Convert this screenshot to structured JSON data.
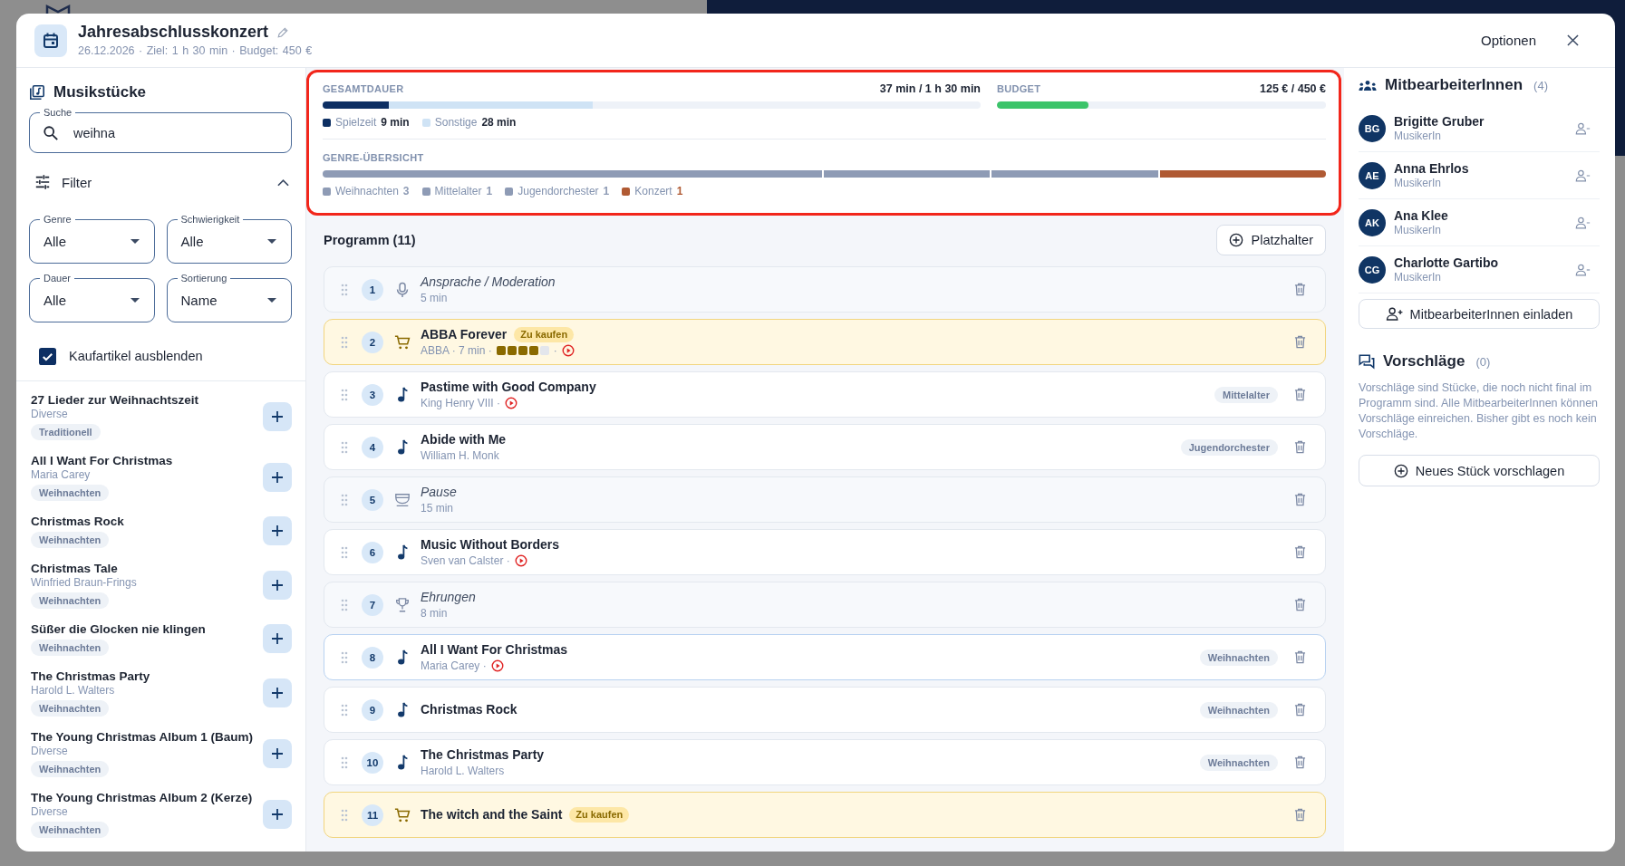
{
  "window": {
    "title": "Jahresabschlusskonzert",
    "meta": "26.12.2026 · Ziel: 1 h 30 min · Budget: 450 €",
    "options": "Optionen"
  },
  "library": {
    "title": "Musikstücke",
    "search": {
      "label": "Suche",
      "value": "weihna"
    },
    "filter": {
      "label": "Filter",
      "expanded": true
    },
    "selects": [
      {
        "label": "Genre",
        "value": "Alle"
      },
      {
        "label": "Schwierigkeit",
        "value": "Alle"
      },
      {
        "label": "Dauer",
        "value": "Alle"
      },
      {
        "label": "Sortierung",
        "value": "Name"
      }
    ],
    "hide_purchases": {
      "label": "Kaufartikel ausblenden",
      "checked": true
    },
    "items": [
      {
        "title": "27 Lieder zur Weihnachtszeit",
        "composer": "Diverse",
        "tag": "Traditionell"
      },
      {
        "title": "All I Want For Christmas",
        "composer": "Maria Carey",
        "tag": "Weihnachten"
      },
      {
        "title": "Christmas Rock",
        "tag": "Weihnachten"
      },
      {
        "title": "Christmas Tale",
        "composer": "Winfried Braun-Frings",
        "tag": "Weihnachten"
      },
      {
        "title": "Süßer die Glocken nie klingen",
        "tag": "Weihnachten"
      },
      {
        "title": "The Christmas Party",
        "composer": "Harold L. Walters",
        "tag": "Weihnachten"
      },
      {
        "title": "The Young Christmas Album 1 (Baum)",
        "composer": "Diverse",
        "tag": "Weihnachten"
      },
      {
        "title": "The Young Christmas Album 2 (Kerze)",
        "composer": "Diverse",
        "tag": "Weihnachten"
      }
    ]
  },
  "summary": {
    "duration": {
      "label": "GESAMTDAUER",
      "reading": "37 min / 1 h 30 min",
      "level": 0.411,
      "segments": [
        {
          "name": "Spielzeit",
          "value": "9 min",
          "level": 0.1,
          "color": "#0d2f63"
        },
        {
          "name": "Sonstige",
          "value": "28 min",
          "color": "#cfe3f5"
        }
      ]
    },
    "budget": {
      "label": "BUDGET",
      "reading": "125 € / 450 €",
      "level": 0.278
    },
    "genres": {
      "label": "GENRE-ÜBERSICHT",
      "items": [
        {
          "name": "Weihnachten",
          "count": "3",
          "color": "#8e9bb5"
        },
        {
          "name": "Mittelalter",
          "count": "1",
          "color": "#8e9bb5"
        },
        {
          "name": "Jugendorchester",
          "count": "1",
          "color": "#8e9bb5"
        },
        {
          "name": "Konzert",
          "count": "1",
          "color": "#b05a33"
        }
      ]
    }
  },
  "program": {
    "title": "Programm (11)",
    "add_placeholder": "Platzhalter",
    "items": [
      {
        "number": "1",
        "kind": "speech",
        "title": "Ansprache / Moderation",
        "details": "5 min",
        "selected": false
      },
      {
        "number": "2",
        "kind": "purchase",
        "title": "ABBA Forever",
        "badge": "Zu kaufen",
        "details": "ABBA · 7 min ·",
        "stars": 4,
        "separator": "·",
        "audio": true,
        "selected": false
      },
      {
        "number": "3",
        "kind": "song",
        "title": "Pastime with Good Company",
        "details": "King Henry VIII ·",
        "audio": true,
        "genre": "Mittelalter",
        "selected": false
      },
      {
        "number": "4",
        "kind": "song",
        "title": "Abide with Me",
        "details": "William H. Monk",
        "genre": "Jugendorchester",
        "selected": false
      },
      {
        "number": "5",
        "kind": "pause",
        "title": "Pause",
        "details": "15 min",
        "selected": false
      },
      {
        "number": "6",
        "kind": "song",
        "title": "Music Without Borders",
        "details": "Sven van Calster ·",
        "audio": true,
        "selected": false
      },
      {
        "number": "7",
        "kind": "honors",
        "title": "Ehrungen",
        "details": "8 min",
        "selected": false
      },
      {
        "number": "8",
        "kind": "song",
        "title": "All I Want For Christmas",
        "details": "Maria Carey ·",
        "audio": true,
        "genre": "Weihnachten",
        "selected": true
      },
      {
        "number": "9",
        "kind": "song",
        "title": "Christmas Rock",
        "genre": "Weihnachten",
        "selected": false
      },
      {
        "number": "10",
        "kind": "song",
        "title": "The Christmas Party",
        "details": "Harold L. Walters",
        "genre": "Weihnachten",
        "selected": false
      },
      {
        "number": "11",
        "kind": "purchase",
        "title": "The witch and the Saint",
        "badge": "Zu kaufen",
        "selected": false
      }
    ]
  },
  "collaborators": {
    "title": "MitbearbeiterInnen",
    "count": "(4)",
    "members": [
      {
        "initials": "BG",
        "name": "Brigitte Gruber",
        "role": "MusikerIn"
      },
      {
        "initials": "AE",
        "name": "Anna Ehrlos",
        "role": "MusikerIn"
      },
      {
        "initials": "AK",
        "name": "Ana Klee",
        "role": "MusikerIn"
      },
      {
        "initials": "CG",
        "name": "Charlotte Gartibo",
        "role": "MusikerIn"
      }
    ],
    "invite": "MitbearbeiterInnen einladen"
  },
  "suggestions": {
    "title": "Vorschläge",
    "count": "(0)",
    "text": "Vorschläge sind Stücke, die noch nicht final im Programm sind. Alle MitbearbeiterInnen können Vorschläge einreichen. Bisher gibt es noch kein Vorschläge.",
    "button": "Neues Stück vorschlagen"
  }
}
